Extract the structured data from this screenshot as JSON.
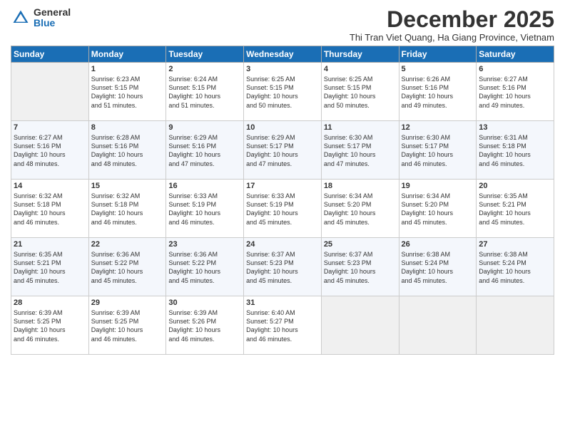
{
  "logo": {
    "general": "General",
    "blue": "Blue"
  },
  "title": "December 2025",
  "subtitle": "Thi Tran Viet Quang, Ha Giang Province, Vietnam",
  "headers": [
    "Sunday",
    "Monday",
    "Tuesday",
    "Wednesday",
    "Thursday",
    "Friday",
    "Saturday"
  ],
  "weeks": [
    [
      {
        "num": "",
        "info": ""
      },
      {
        "num": "1",
        "info": "Sunrise: 6:23 AM\nSunset: 5:15 PM\nDaylight: 10 hours\nand 51 minutes."
      },
      {
        "num": "2",
        "info": "Sunrise: 6:24 AM\nSunset: 5:15 PM\nDaylight: 10 hours\nand 51 minutes."
      },
      {
        "num": "3",
        "info": "Sunrise: 6:25 AM\nSunset: 5:15 PM\nDaylight: 10 hours\nand 50 minutes."
      },
      {
        "num": "4",
        "info": "Sunrise: 6:25 AM\nSunset: 5:15 PM\nDaylight: 10 hours\nand 50 minutes."
      },
      {
        "num": "5",
        "info": "Sunrise: 6:26 AM\nSunset: 5:16 PM\nDaylight: 10 hours\nand 49 minutes."
      },
      {
        "num": "6",
        "info": "Sunrise: 6:27 AM\nSunset: 5:16 PM\nDaylight: 10 hours\nand 49 minutes."
      }
    ],
    [
      {
        "num": "7",
        "info": "Sunrise: 6:27 AM\nSunset: 5:16 PM\nDaylight: 10 hours\nand 48 minutes."
      },
      {
        "num": "8",
        "info": "Sunrise: 6:28 AM\nSunset: 5:16 PM\nDaylight: 10 hours\nand 48 minutes."
      },
      {
        "num": "9",
        "info": "Sunrise: 6:29 AM\nSunset: 5:16 PM\nDaylight: 10 hours\nand 47 minutes."
      },
      {
        "num": "10",
        "info": "Sunrise: 6:29 AM\nSunset: 5:17 PM\nDaylight: 10 hours\nand 47 minutes."
      },
      {
        "num": "11",
        "info": "Sunrise: 6:30 AM\nSunset: 5:17 PM\nDaylight: 10 hours\nand 47 minutes."
      },
      {
        "num": "12",
        "info": "Sunrise: 6:30 AM\nSunset: 5:17 PM\nDaylight: 10 hours\nand 46 minutes."
      },
      {
        "num": "13",
        "info": "Sunrise: 6:31 AM\nSunset: 5:18 PM\nDaylight: 10 hours\nand 46 minutes."
      }
    ],
    [
      {
        "num": "14",
        "info": "Sunrise: 6:32 AM\nSunset: 5:18 PM\nDaylight: 10 hours\nand 46 minutes."
      },
      {
        "num": "15",
        "info": "Sunrise: 6:32 AM\nSunset: 5:18 PM\nDaylight: 10 hours\nand 46 minutes."
      },
      {
        "num": "16",
        "info": "Sunrise: 6:33 AM\nSunset: 5:19 PM\nDaylight: 10 hours\nand 46 minutes."
      },
      {
        "num": "17",
        "info": "Sunrise: 6:33 AM\nSunset: 5:19 PM\nDaylight: 10 hours\nand 45 minutes."
      },
      {
        "num": "18",
        "info": "Sunrise: 6:34 AM\nSunset: 5:20 PM\nDaylight: 10 hours\nand 45 minutes."
      },
      {
        "num": "19",
        "info": "Sunrise: 6:34 AM\nSunset: 5:20 PM\nDaylight: 10 hours\nand 45 minutes."
      },
      {
        "num": "20",
        "info": "Sunrise: 6:35 AM\nSunset: 5:21 PM\nDaylight: 10 hours\nand 45 minutes."
      }
    ],
    [
      {
        "num": "21",
        "info": "Sunrise: 6:35 AM\nSunset: 5:21 PM\nDaylight: 10 hours\nand 45 minutes."
      },
      {
        "num": "22",
        "info": "Sunrise: 6:36 AM\nSunset: 5:22 PM\nDaylight: 10 hours\nand 45 minutes."
      },
      {
        "num": "23",
        "info": "Sunrise: 6:36 AM\nSunset: 5:22 PM\nDaylight: 10 hours\nand 45 minutes."
      },
      {
        "num": "24",
        "info": "Sunrise: 6:37 AM\nSunset: 5:23 PM\nDaylight: 10 hours\nand 45 minutes."
      },
      {
        "num": "25",
        "info": "Sunrise: 6:37 AM\nSunset: 5:23 PM\nDaylight: 10 hours\nand 45 minutes."
      },
      {
        "num": "26",
        "info": "Sunrise: 6:38 AM\nSunset: 5:24 PM\nDaylight: 10 hours\nand 45 minutes."
      },
      {
        "num": "27",
        "info": "Sunrise: 6:38 AM\nSunset: 5:24 PM\nDaylight: 10 hours\nand 46 minutes."
      }
    ],
    [
      {
        "num": "28",
        "info": "Sunrise: 6:39 AM\nSunset: 5:25 PM\nDaylight: 10 hours\nand 46 minutes."
      },
      {
        "num": "29",
        "info": "Sunrise: 6:39 AM\nSunset: 5:25 PM\nDaylight: 10 hours\nand 46 minutes."
      },
      {
        "num": "30",
        "info": "Sunrise: 6:39 AM\nSunset: 5:26 PM\nDaylight: 10 hours\nand 46 minutes."
      },
      {
        "num": "31",
        "info": "Sunrise: 6:40 AM\nSunset: 5:27 PM\nDaylight: 10 hours\nand 46 minutes."
      },
      {
        "num": "",
        "info": ""
      },
      {
        "num": "",
        "info": ""
      },
      {
        "num": "",
        "info": ""
      }
    ]
  ]
}
